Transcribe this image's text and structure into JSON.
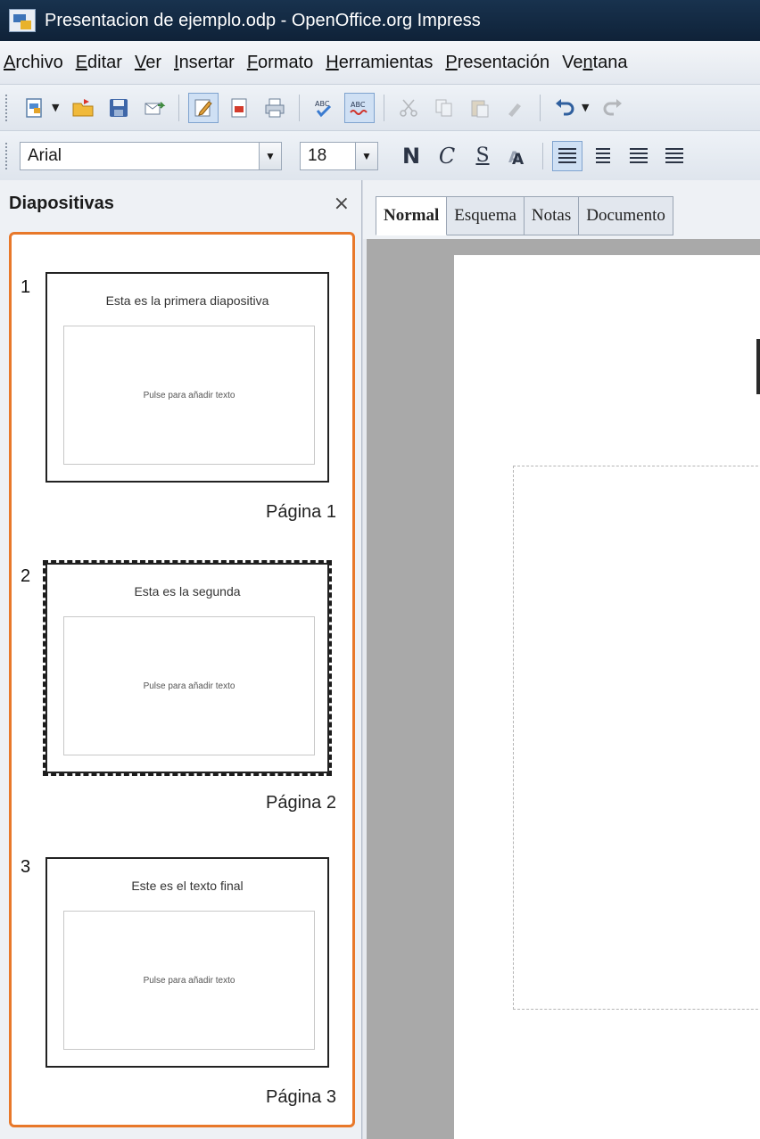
{
  "window": {
    "title": "Presentacion de ejemplo.odp - OpenOffice.org Impress"
  },
  "menu": [
    {
      "pre": "",
      "ul": "A",
      "post": "rchivo"
    },
    {
      "pre": "",
      "ul": "E",
      "post": "ditar"
    },
    {
      "pre": "",
      "ul": "V",
      "post": "er"
    },
    {
      "pre": "",
      "ul": "I",
      "post": "nsertar"
    },
    {
      "pre": "",
      "ul": "F",
      "post": "ormato"
    },
    {
      "pre": "",
      "ul": "H",
      "post": "erramientas"
    },
    {
      "pre": "",
      "ul": "P",
      "post": "resentación"
    },
    {
      "pre": "Ve",
      "ul": "n",
      "post": "tana"
    }
  ],
  "format_toolbar": {
    "font_name": "Arial",
    "font_size": "18",
    "bold": "N",
    "italic": "C",
    "underline": "S"
  },
  "slides_pane": {
    "title": "Diapositivas",
    "close": "×",
    "slides": [
      {
        "number": "1",
        "title": "Esta es la primera diapositiva",
        "placeholder": "Pulse para añadir texto",
        "page_label": "Página 1",
        "selected": false
      },
      {
        "number": "2",
        "title": "Esta es la segunda",
        "placeholder": "Pulse para añadir texto",
        "page_label": "Página 2",
        "selected": true
      },
      {
        "number": "3",
        "title": "Este es el texto final",
        "placeholder": "Pulse para añadir texto",
        "page_label": "Página 3",
        "selected": false
      }
    ]
  },
  "view_tabs": [
    "Normal",
    "Esquema",
    "Notas",
    "Documento"
  ],
  "active_tab": "Normal",
  "colors": {
    "accent_orange": "#e8782a",
    "titlebar": "#18324e"
  }
}
